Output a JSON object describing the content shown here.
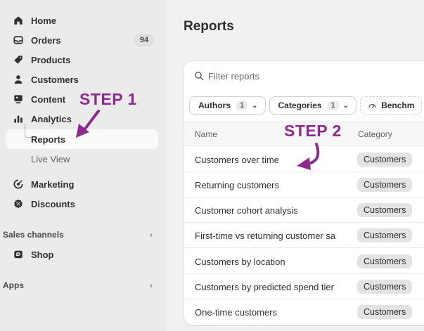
{
  "sidebar": {
    "items": [
      {
        "label": "Home",
        "icon": "home-icon"
      },
      {
        "label": "Orders",
        "icon": "orders-icon",
        "badge": "94"
      },
      {
        "label": "Products",
        "icon": "tag-icon"
      },
      {
        "label": "Customers",
        "icon": "person-icon"
      },
      {
        "label": "Content",
        "icon": "content-icon"
      },
      {
        "label": "Analytics",
        "icon": "analytics-icon"
      }
    ],
    "analytics_sub": [
      {
        "label": "Reports"
      },
      {
        "label": "Live View"
      }
    ],
    "items2": [
      {
        "label": "Marketing",
        "icon": "target-icon"
      },
      {
        "label": "Discounts",
        "icon": "discount-icon"
      }
    ],
    "sales_channels": {
      "label": "Sales channels",
      "shop": "Shop"
    },
    "apps": {
      "label": "Apps"
    }
  },
  "page": {
    "title": "Reports"
  },
  "search": {
    "placeholder": "Filter reports"
  },
  "filters": [
    {
      "label": "Authors",
      "count": "1"
    },
    {
      "label": "Categories",
      "count": "1"
    },
    {
      "label": "Benchm"
    }
  ],
  "table": {
    "headers": {
      "name": "Name",
      "category": "Category"
    },
    "rows": [
      {
        "name": "Customers over time",
        "category": "Customers"
      },
      {
        "name": "Returning customers",
        "category": "Customers"
      },
      {
        "name": "Customer cohort analysis",
        "category": "Customers"
      },
      {
        "name": "First-time vs returning customer sa",
        "category": "Customers"
      },
      {
        "name": "Customers by location",
        "category": "Customers"
      },
      {
        "name": "Customers by predicted spend tier",
        "category": "Customers"
      },
      {
        "name": "One-time customers",
        "category": "Customers"
      }
    ]
  },
  "annotations": {
    "step1": "STEP 1",
    "step2": "STEP 2",
    "color": "#8e2a8e"
  }
}
